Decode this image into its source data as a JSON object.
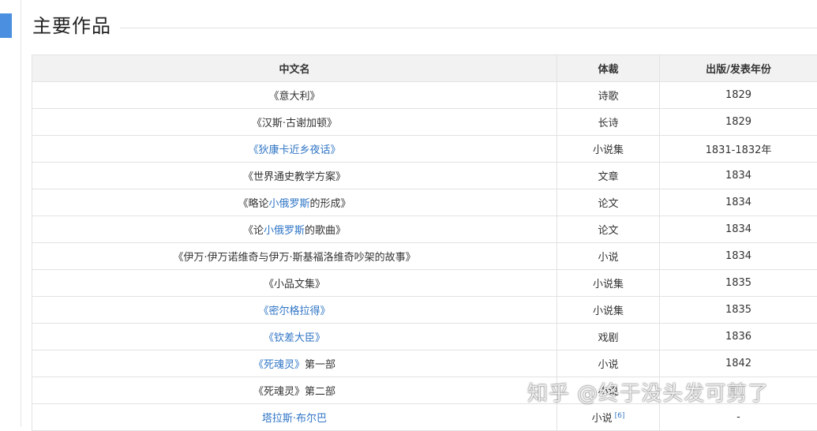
{
  "section": {
    "title": "主要作品"
  },
  "table": {
    "headers": [
      "中文名",
      "体裁",
      "出版/发表年份"
    ],
    "rows": [
      {
        "name": [
          {
            "t": "《意大利》"
          }
        ],
        "genre": "诗歌",
        "year": "1829",
        "ref": ""
      },
      {
        "name": [
          {
            "t": "《汉斯·古谢加顿》"
          }
        ],
        "genre": "长诗",
        "year": "1829",
        "ref": ""
      },
      {
        "name": [
          {
            "t": "《狄康卡近乡夜话》",
            "link": true
          }
        ],
        "genre": "小说集",
        "year": "1831-1832年",
        "ref": ""
      },
      {
        "name": [
          {
            "t": "《世界通史教学方案》"
          }
        ],
        "genre": "文章",
        "year": "1834",
        "ref": ""
      },
      {
        "name": [
          {
            "t": "《略论"
          },
          {
            "t": "小俄罗斯",
            "link": true
          },
          {
            "t": "的形成》"
          }
        ],
        "genre": "论文",
        "year": "1834",
        "ref": ""
      },
      {
        "name": [
          {
            "t": "《论"
          },
          {
            "t": "小俄罗斯",
            "link": true
          },
          {
            "t": "的歌曲》"
          }
        ],
        "genre": "论文",
        "year": "1834",
        "ref": ""
      },
      {
        "name": [
          {
            "t": "《伊万·伊万诺维奇与伊万·斯基福洛维奇吵架的故事》"
          }
        ],
        "genre": "小说",
        "year": "1834",
        "ref": ""
      },
      {
        "name": [
          {
            "t": "《小品文集》"
          }
        ],
        "genre": "小说集",
        "year": "1835",
        "ref": ""
      },
      {
        "name": [
          {
            "t": "《密尔格拉得》",
            "link": true
          }
        ],
        "genre": "小说集",
        "year": "1835",
        "ref": ""
      },
      {
        "name": [
          {
            "t": "《钦差大臣》",
            "link": true
          }
        ],
        "genre": "戏剧",
        "year": "1836",
        "ref": ""
      },
      {
        "name": [
          {
            "t": "《死魂灵》",
            "link": true
          },
          {
            "t": "第一部"
          }
        ],
        "genre": "小说",
        "year": "1842",
        "ref": ""
      },
      {
        "name": [
          {
            "t": "《死魂灵》第二部"
          }
        ],
        "genre": "小说",
        "year": "",
        "ref": ""
      },
      {
        "name": [
          {
            "t": "塔拉斯·布尔巴",
            "link": true
          }
        ],
        "genre": "小说",
        "year": "-",
        "ref": "[6]"
      }
    ]
  },
  "watermark": "知乎 @终于没头发可剪了",
  "colors": {
    "accent": "#4a8fe0",
    "link": "#2f75c6",
    "header_bg": "#f2f2f2",
    "border": "#e2e2e2"
  }
}
